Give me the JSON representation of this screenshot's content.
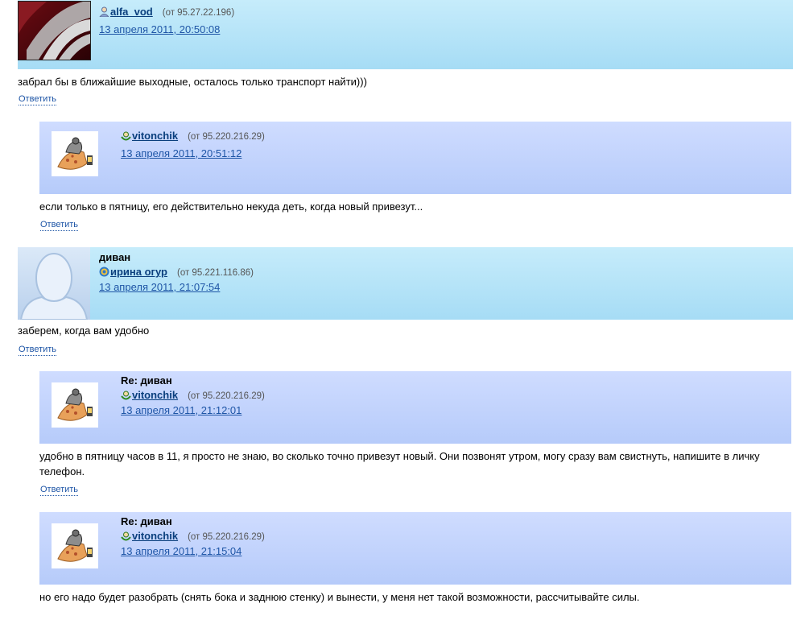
{
  "comments": [
    {
      "title": "",
      "author": "alfa_vod",
      "ip": "(от 95.27.22.196)",
      "date": "13 апреля 2011, 20:50:08",
      "text": "забрал бы в ближайшие выходные, осталось только транспорт найти)))",
      "reply_label": "Ответить",
      "icon": "person-icon"
    },
    {
      "title": "",
      "author": "vitonchik",
      "ip": "(от 95.220.216.29)",
      "date": "13 апреля 2011, 20:51:12",
      "text": "если только в пятницу, его действительно некуда деть, когда новый привезут...",
      "reply_label": "Ответить",
      "icon": "green-user-icon"
    },
    {
      "title": "диван",
      "author": "ирина огур",
      "ip": "(от 95.221.116.86)",
      "date": "13 апреля 2011, 21:07:54",
      "text": "заберем, когда вам удобно",
      "reply_label": "Ответить",
      "icon": "social-icon"
    },
    {
      "title": "Re: диван",
      "author": "vitonchik",
      "ip": "(от 95.220.216.29)",
      "date": "13 апреля 2011, 21:12:01",
      "text": "удобно в пятницу часов в 11, я просто не знаю, во сколько точно привезут новый. Они позвонят утром, могу сразу вам свистнуть, напишите в личку телефон.",
      "reply_label": "Ответить",
      "icon": "green-user-icon"
    },
    {
      "title": "Re: диван",
      "author": "vitonchik",
      "ip": "(от 95.220.216.29)",
      "date": "13 апреля 2011, 21:15:04",
      "text": "но его надо будет разобрать (снять бока и заднюю стенку) и вынести, у меня нет такой возможности, рассчитывайте силы.",
      "reply_label": "",
      "icon": "green-user-icon"
    }
  ]
}
